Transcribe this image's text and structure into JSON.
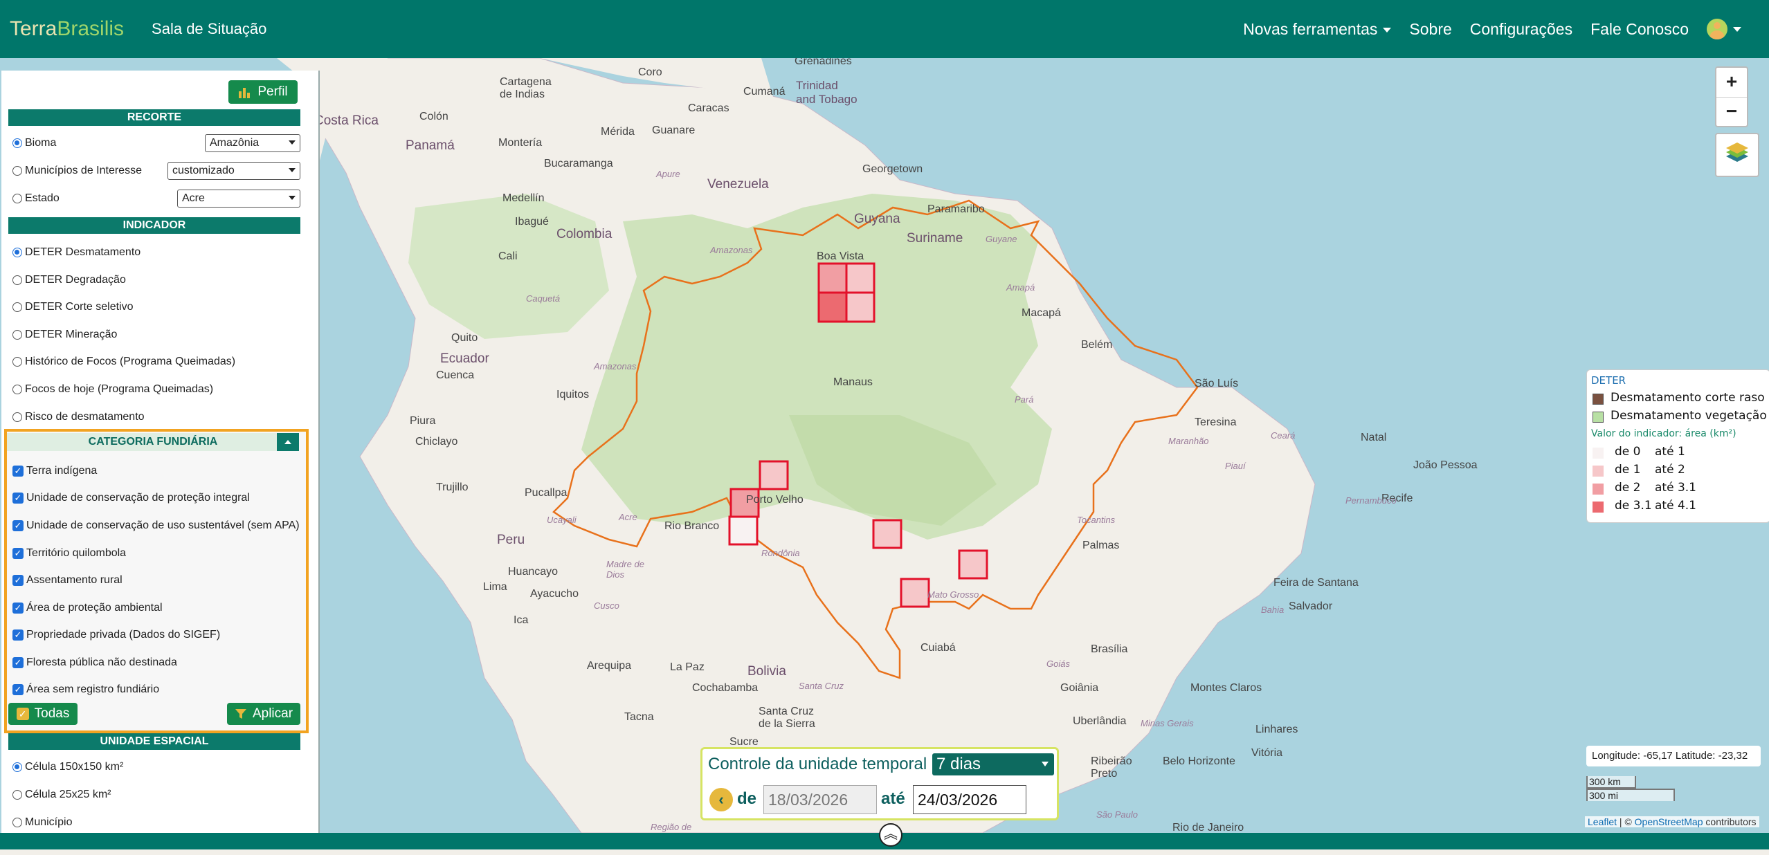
{
  "navbar": {
    "brand_part1": "Terra",
    "brand_part2": "Brasilis",
    "subtitle": "Sala de Situação",
    "links": [
      "Novas ferramentas",
      "Sobre",
      "Configurações",
      "Fale Conosco"
    ]
  },
  "panel": {
    "perfil_button": "Perfil",
    "recorte": {
      "title": "RECORTE",
      "options": [
        {
          "label": "Bioma",
          "value": "Amazônia",
          "selected": true
        },
        {
          "label": "Municípios de Interesse",
          "value": "customizado",
          "selected": false
        },
        {
          "label": "Estado",
          "value": "Acre",
          "selected": false
        }
      ]
    },
    "indicador": {
      "title": "INDICADOR",
      "options": [
        "DETER Desmatamento",
        "DETER Degradação",
        "DETER Corte seletivo",
        "DETER Mineração",
        "Histórico de Focos (Programa Queimadas)",
        "Focos de hoje (Programa Queimadas)",
        "Risco de desmatamento"
      ],
      "selected": "DETER Desmatamento"
    },
    "categoria": {
      "title": "CATEGORIA FUNDIÁRIA",
      "items": [
        "Terra indígena",
        "Unidade de conservação de proteção integral",
        "Unidade de conservação de uso sustentável (sem APA)",
        "Território quilombola",
        "Assentamento rural",
        "Área de proteção ambiental",
        "Propriedade privada (Dados do SIGEF)",
        "Floresta pública não destinada",
        "Área sem registro fundiário"
      ],
      "todas_button": "Todas",
      "aplicar_button": "Aplicar"
    },
    "unidade": {
      "title": "UNIDADE ESPACIAL",
      "options": [
        "Célula 150x150 km²",
        "Célula 25x25 km²",
        "Município"
      ],
      "selected": "Célula 150x150 km²"
    }
  },
  "legend": {
    "title": "DETER",
    "layers": [
      {
        "label": "Desmatamento corte raso",
        "color": "#7a5140"
      },
      {
        "label": "Desmatamento vegetação",
        "color": "#b8e0a4"
      }
    ],
    "indicator_title": "Valor do indicador: área (km²)",
    "classes": [
      {
        "from": "de 0",
        "to": "até 1",
        "color": "#f8f2f2"
      },
      {
        "from": "de 1",
        "to": "até 2",
        "color": "#f6c7c9"
      },
      {
        "from": "de 2",
        "to": "até 3.1",
        "color": "#f19ea3"
      },
      {
        "from": "de 3.1",
        "to": "até 4.1",
        "color": "#ec6a70"
      }
    ]
  },
  "map": {
    "zoom_in": "+",
    "zoom_out": "−",
    "coordinates": "Longitude: -65,17 Latitude: -23,32",
    "scale_km": "300 km",
    "scale_mi": "300 mi",
    "attribution_leaflet": "Leaflet",
    "attribution_sep": " | © ",
    "attribution_osm": "OpenStreetMap",
    "attribution_tail": " contributors",
    "labels": [
      {
        "text": "Grenadines",
        "cls": "city"
      },
      {
        "text": "Cartagena de Indias",
        "cls": "city"
      },
      {
        "text": "Coro",
        "cls": "city"
      },
      {
        "text": "Caracas",
        "cls": "city"
      },
      {
        "text": "Cumaná",
        "cls": "city"
      },
      {
        "text": "Trinidad and Tobago",
        "cls": "country"
      },
      {
        "text": "Colón",
        "cls": "city"
      },
      {
        "text": "Montería",
        "cls": "city"
      },
      {
        "text": "Mérida",
        "cls": "city"
      },
      {
        "text": "Guanare",
        "cls": "city"
      },
      {
        "text": "Bucaramanga",
        "cls": "city"
      },
      {
        "text": "Apure",
        "cls": "state"
      },
      {
        "text": "Venezuela",
        "cls": "country"
      },
      {
        "text": "Georgetown",
        "cls": "city"
      },
      {
        "text": "Medellín",
        "cls": "city"
      },
      {
        "text": "Ibagué",
        "cls": "city"
      },
      {
        "text": "Colombia",
        "cls": "country"
      },
      {
        "text": "Guyana",
        "cls": "country"
      },
      {
        "text": "Paramaribo",
        "cls": "city"
      },
      {
        "text": "Suriname",
        "cls": "country"
      },
      {
        "text": "Guyane",
        "cls": "state"
      },
      {
        "text": "Cali",
        "cls": "city"
      },
      {
        "text": "Amazonas",
        "cls": "state"
      },
      {
        "text": "Boa Vista",
        "cls": "city"
      },
      {
        "text": "Amapá",
        "cls": "state"
      },
      {
        "text": "Macapá",
        "cls": "city"
      },
      {
        "text": "Caquetá",
        "cls": "state"
      },
      {
        "text": "Belém",
        "cls": "city"
      },
      {
        "text": "Quito",
        "cls": "city"
      },
      {
        "text": "Ecuador",
        "cls": "country"
      },
      {
        "text": "Cuenca",
        "cls": "city"
      },
      {
        "text": "Amazonas",
        "cls": "state"
      },
      {
        "text": "Manaus",
        "cls": "city"
      },
      {
        "text": "São Luís",
        "cls": "city"
      },
      {
        "text": "Iquitos",
        "cls": "city"
      },
      {
        "text": "Pará",
        "cls": "state"
      },
      {
        "text": "Teresina",
        "cls": "city"
      },
      {
        "text": "Piura",
        "cls": "city"
      },
      {
        "text": "Chiclayo",
        "cls": "city"
      },
      {
        "text": "Maranhão",
        "cls": "state"
      },
      {
        "text": "Ceará",
        "cls": "state"
      },
      {
        "text": "Natal",
        "cls": "city"
      },
      {
        "text": "Trujillo",
        "cls": "city"
      },
      {
        "text": "João Pessoa",
        "cls": "city"
      },
      {
        "text": "Pucallpa",
        "cls": "city"
      },
      {
        "text": "Porto Velho",
        "cls": "city"
      },
      {
        "text": "Piauí",
        "cls": "state"
      },
      {
        "text": "Recife",
        "cls": "city"
      },
      {
        "text": "Ucayali",
        "cls": "state"
      },
      {
        "text": "Acre",
        "cls": "state"
      },
      {
        "text": "Pernambuco",
        "cls": "state"
      },
      {
        "text": "Rio Branco",
        "cls": "city"
      },
      {
        "text": "Tocantins",
        "cls": "state"
      },
      {
        "text": "Peru",
        "cls": "country"
      },
      {
        "text": "Palmas",
        "cls": "city"
      },
      {
        "text": "Rondônia",
        "cls": "state"
      },
      {
        "text": "Huancayo",
        "cls": "city"
      },
      {
        "text": "Madre de Dios",
        "cls": "state"
      },
      {
        "text": "Feira de Santana",
        "cls": "city"
      },
      {
        "text": "Lima",
        "cls": "city"
      },
      {
        "text": "Ayacucho",
        "cls": "city"
      },
      {
        "text": "Mato Grosso",
        "cls": "state"
      },
      {
        "text": "Bahia",
        "cls": "state"
      },
      {
        "text": "Salvador",
        "cls": "city"
      },
      {
        "text": "Cusco",
        "cls": "state"
      },
      {
        "text": "Ica",
        "cls": "city"
      },
      {
        "text": "Cuiabá",
        "cls": "city"
      },
      {
        "text": "Brasília",
        "cls": "city"
      },
      {
        "text": "Arequipa",
        "cls": "city"
      },
      {
        "text": "La Paz",
        "cls": "city"
      },
      {
        "text": "Bolivia",
        "cls": "country"
      },
      {
        "text": "Goiás",
        "cls": "state"
      },
      {
        "text": "Cochabamba",
        "cls": "city"
      },
      {
        "text": "Santa Cruz",
        "cls": "state"
      },
      {
        "text": "Goiânia",
        "cls": "city"
      },
      {
        "text": "Montes Claros",
        "cls": "city"
      },
      {
        "text": "Tacna",
        "cls": "city"
      },
      {
        "text": "Santa Cruz de la Sierra",
        "cls": "city"
      },
      {
        "text": "Uberlândia",
        "cls": "city"
      },
      {
        "text": "Minas Gerais",
        "cls": "state"
      },
      {
        "text": "Linhares",
        "cls": "city"
      },
      {
        "text": "Sucre",
        "cls": "city"
      },
      {
        "text": "Vitória",
        "cls": "city"
      },
      {
        "text": "Ribeirão Preto",
        "cls": "city"
      },
      {
        "text": "Belo Horizonte",
        "cls": "city"
      },
      {
        "text": "São Paulo",
        "cls": "state"
      },
      {
        "text": "Região de",
        "cls": "state"
      },
      {
        "text": "Rio de Janeiro",
        "cls": "city"
      },
      {
        "text": "Costa Rica",
        "cls": "country"
      },
      {
        "text": "Panamá",
        "cls": "country"
      }
    ]
  },
  "time_control": {
    "title": "Controle da unidade temporal",
    "period": "7 dias",
    "de_label": "de",
    "date_from": "18/03/2026",
    "ate_label": "até",
    "date_to": "24/03/2026"
  }
}
